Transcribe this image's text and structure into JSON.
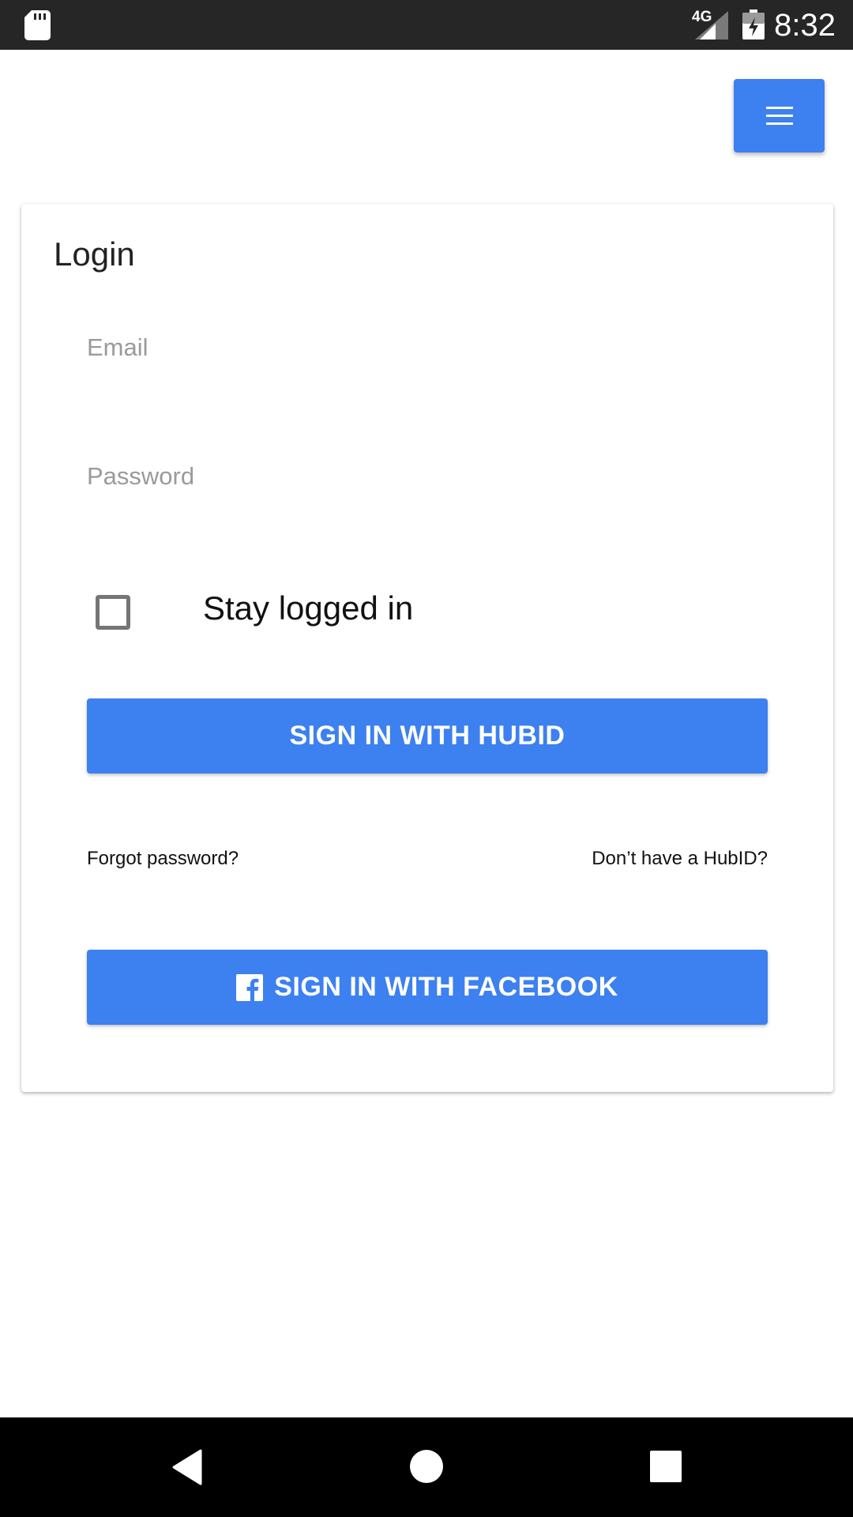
{
  "status_bar": {
    "network_label": "4G",
    "time": "8:32"
  },
  "icons": {
    "sd_card": "sd-card-icon",
    "signal": "cell-signal-icon",
    "battery": "battery-charging-icon",
    "menu": "hamburger-menu-icon",
    "facebook": "facebook-icon",
    "nav_back": "back-triangle-icon",
    "nav_home": "home-circle-icon",
    "nav_recents": "recents-square-icon"
  },
  "colors": {
    "accent": "#3d80f0",
    "status_bar": "#262626",
    "nav_bar": "#000000"
  },
  "login": {
    "title": "Login",
    "email": {
      "value": "",
      "placeholder": "Email"
    },
    "password": {
      "value": "",
      "placeholder": "Password"
    },
    "stay_logged_in": {
      "label": "Stay logged in",
      "checked": false
    },
    "hubid_button": "SIGN IN WITH HUBID",
    "forgot_password": "Forgot password?",
    "no_hubid": "Don’t have a HubID?",
    "facebook_button": "SIGN IN WITH FACEBOOK"
  }
}
